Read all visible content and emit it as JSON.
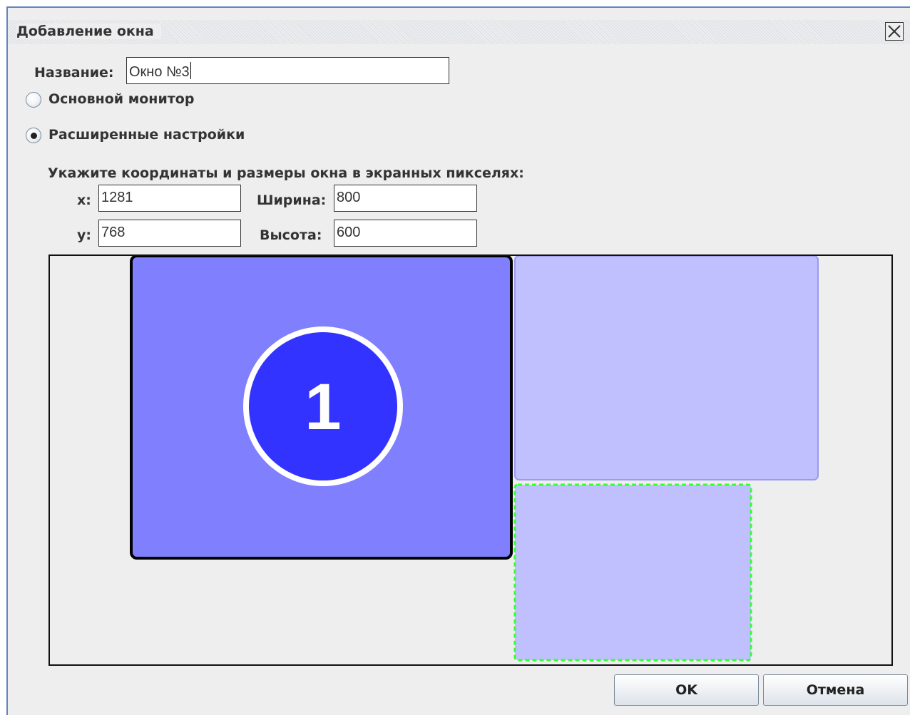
{
  "window": {
    "title": "Добавление окна",
    "close_icon": "close-icon"
  },
  "form": {
    "name_label": "Название:",
    "name_value": "Окно №3",
    "radio_primary_label": "Основной монитор",
    "radio_primary_selected": false,
    "radio_advanced_label": "Расширенные настройки",
    "radio_advanced_selected": true,
    "coords_heading": "Укажите координаты и размеры окна в экранных пикселях:",
    "x_label": "x:",
    "x_value": "1281",
    "y_label": "y:",
    "y_value": "768",
    "width_label": "Ширина:",
    "width_value": "800",
    "height_label": "Высота:",
    "height_value": "600"
  },
  "preview": {
    "monitors": [
      {
        "label": "1",
        "color": "#8080ff",
        "active": true
      },
      {
        "label": "",
        "color": "#c0c0ff",
        "active": false
      }
    ],
    "new_window": {
      "color": "#c0c0ff",
      "border_color": "#33ff33"
    },
    "badge_color": "#3333ff",
    "badge_text_color": "#ffffff"
  },
  "buttons": {
    "ok_label": "OK",
    "cancel_label": "Отмена"
  }
}
